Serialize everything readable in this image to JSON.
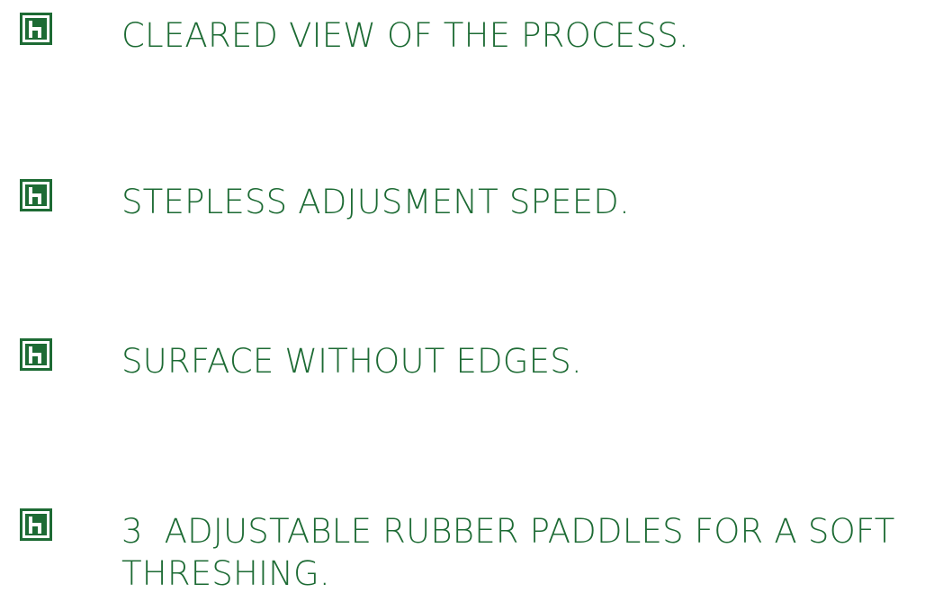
{
  "accent_color": "#1d6b34",
  "bullets": [
    {
      "icon": "logo-bullet-icon",
      "text": "CLEARED VIEW OF THE PROCESS."
    },
    {
      "icon": "logo-bullet-icon",
      "text": "STEPLESS ADJUSMENT SPEED."
    },
    {
      "icon": "logo-bullet-icon",
      "text": "SURFACE WITHOUT EDGES."
    },
    {
      "icon": "logo-bullet-icon",
      "text": "3  ADJUSTABLE RUBBER PADDLES FOR A SOFT THRESHING."
    }
  ]
}
